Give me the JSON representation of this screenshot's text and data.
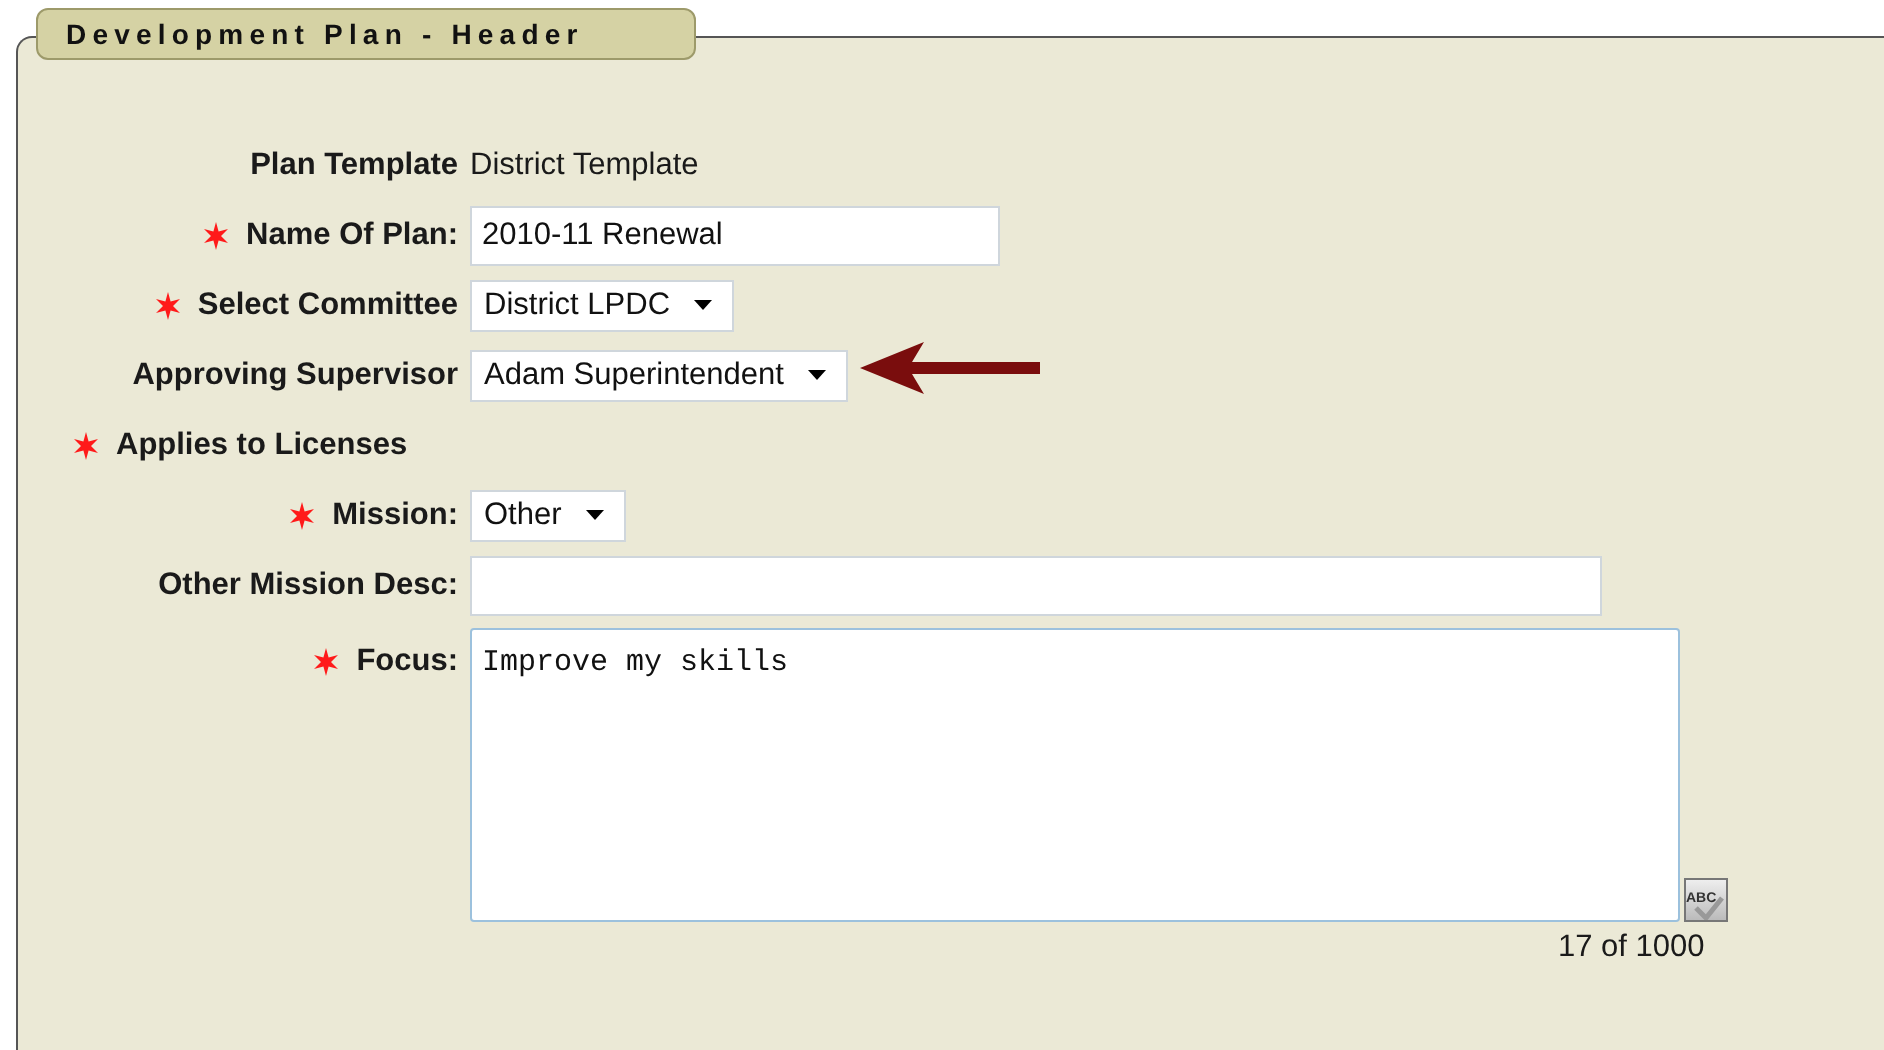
{
  "panel": {
    "title": "Development Plan - Header"
  },
  "fields": [
    {
      "kind": "text",
      "label": "Plan Template",
      "required": false,
      "value": "District Template"
    },
    {
      "kind": "input",
      "label": "Name Of Plan:",
      "required": true,
      "value": "2010-11 Renewal"
    },
    {
      "kind": "select",
      "label": "Select Committee",
      "required": true,
      "value": "District LPDC"
    },
    {
      "kind": "select",
      "label": "Approving Supervisor",
      "required": false,
      "value": "Adam Superintendent",
      "pointer": true
    },
    {
      "kind": "heading",
      "label": "Applies to Licenses",
      "required": true
    },
    {
      "kind": "select",
      "label": "Mission:",
      "required": true,
      "value": "Other"
    },
    {
      "kind": "input",
      "label": "Other Mission Desc:",
      "required": false
    },
    {
      "kind": "textarea",
      "label": "Focus:",
      "required": true,
      "value": "Improve my skills",
      "counter": "17 of 1000",
      "spellcheck_label": "ABC"
    }
  ]
}
